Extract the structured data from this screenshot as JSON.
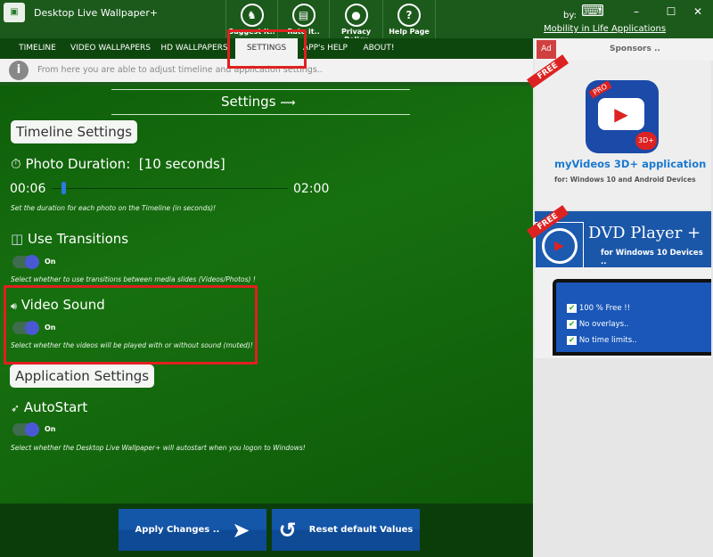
{
  "app": {
    "title": "Desktop Live Wallpaper+",
    "by": "by:",
    "company": "Mobility in Life Applications"
  },
  "toolbar": [
    {
      "label": "Suggest it..",
      "icon": "suggest-icon"
    },
    {
      "label": "Rate it..",
      "icon": "rate-icon"
    },
    {
      "label": "Privacy Policy",
      "icon": "privacy-icon"
    },
    {
      "label": "Help Page",
      "icon": "help-icon"
    }
  ],
  "window_controls": {
    "minimize": "–",
    "maximize": "☐",
    "close": "✕"
  },
  "tabs": [
    {
      "label": "TIMELINE"
    },
    {
      "label": "VIDEO WALLPAPERS !"
    },
    {
      "label": "HD WALLPAPERS"
    },
    {
      "label": "SETTINGS",
      "active": true
    },
    {
      "label": "APP's HELP"
    },
    {
      "label": "ABOUT!"
    }
  ],
  "info": "From here you are able to adjust timeline and application settings..",
  "settings": {
    "title": "Settings",
    "timeline_header": "Timeline Settings",
    "photo_duration": {
      "label": "Photo Duration:",
      "value": "[10 seconds]",
      "min": "00:06",
      "max": "02:00",
      "slider_fraction": 0.04,
      "hint": "Set the duration for each photo on the Timeline (in seconds)!"
    },
    "transitions": {
      "label": "Use Transitions",
      "state": "On",
      "hint": "Select whether to use transitions between media slides (Videos/Photos) !"
    },
    "video_sound": {
      "label": "Video Sound",
      "state": "On",
      "hint": "Select whether the videos will be played with or without sound (muted)!"
    },
    "app_header": "Application Settings",
    "autostart": {
      "label": "AutoStart",
      "state": "On",
      "hint": "Select whether the Desktop Live Wallpaper+ will autostart when you logon to Windows!"
    }
  },
  "buttons": {
    "apply": "Apply Changes ..",
    "reset": "Reset default Values"
  },
  "sponsors": {
    "ad_tag": "Ad",
    "title": "Sponsors ..",
    "ad1": {
      "badge": "FREE",
      "pro": "PRO",
      "tag": "3D+",
      "title": "myVideos 3D+ application",
      "subtitle": "for: Windows 10 and Android Devices"
    },
    "ad2": {
      "badge": "FREE",
      "title": "DVD Player",
      "plus": "+",
      "subtitle": "for Windows 10 Devices ..",
      "features": [
        "100 % Free !!",
        "No overlays..",
        "No time limits.."
      ]
    }
  },
  "colors": {
    "accent_toggle": "#4a58d4",
    "highlight": "#e02020",
    "button": "#1456a8"
  }
}
